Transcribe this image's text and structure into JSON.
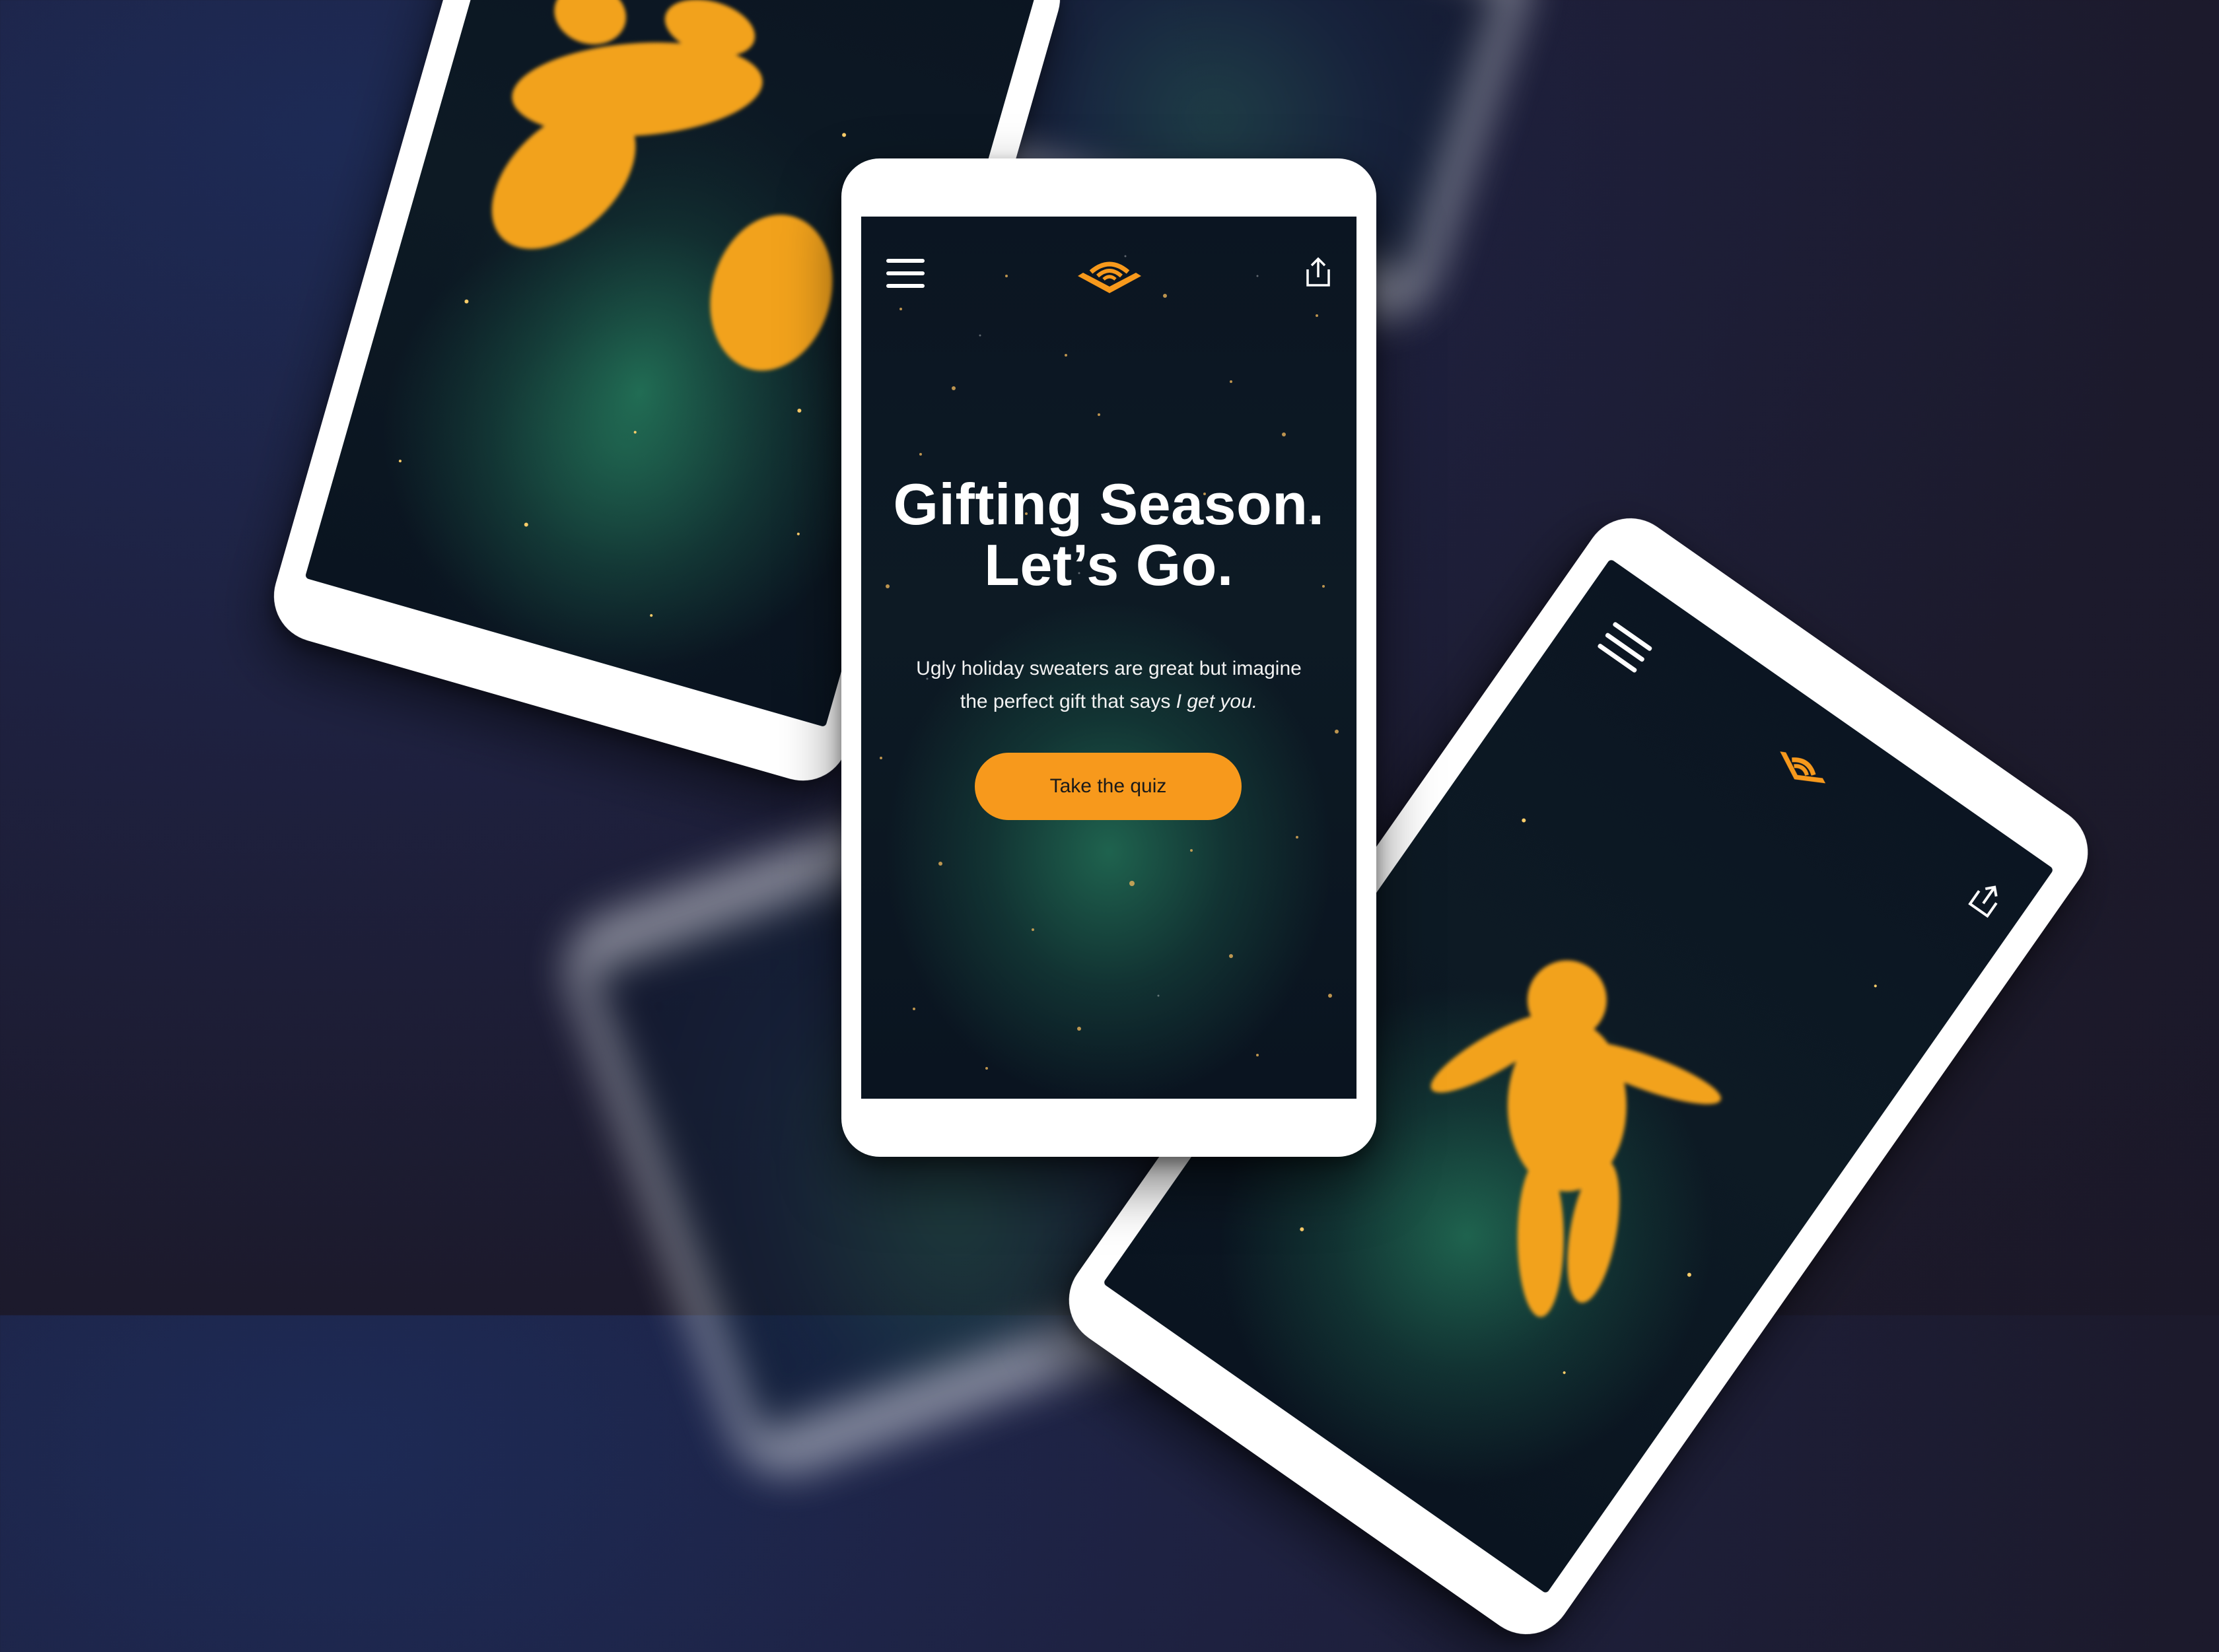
{
  "colors": {
    "accent": "#f7991c",
    "background": "#1c1a2c",
    "screen_dark": "#0b1522",
    "glow_green": "#227056",
    "particle_gold": "#f2a21c"
  },
  "center_phone": {
    "header": {
      "menu_icon": "hamburger-menu-icon",
      "logo_icon": "audible-logo-icon",
      "share_icon": "share-icon"
    },
    "headline_line1": "Gifting Season.",
    "headline_line2": "Let’s Go.",
    "subcopy_main": "Ugly holiday sweaters are great but imagine the perfect gift that says ",
    "subcopy_emphasis": "I get you.",
    "cta_label": "Take the quiz"
  },
  "left_phone": {
    "artwork": "golden-particle-airplane"
  },
  "right_phone": {
    "menu_icon": "hamburger-menu-icon",
    "logo_icon": "audible-logo-icon",
    "share_icon": "share-icon",
    "artwork": "golden-particle-astronaut"
  }
}
